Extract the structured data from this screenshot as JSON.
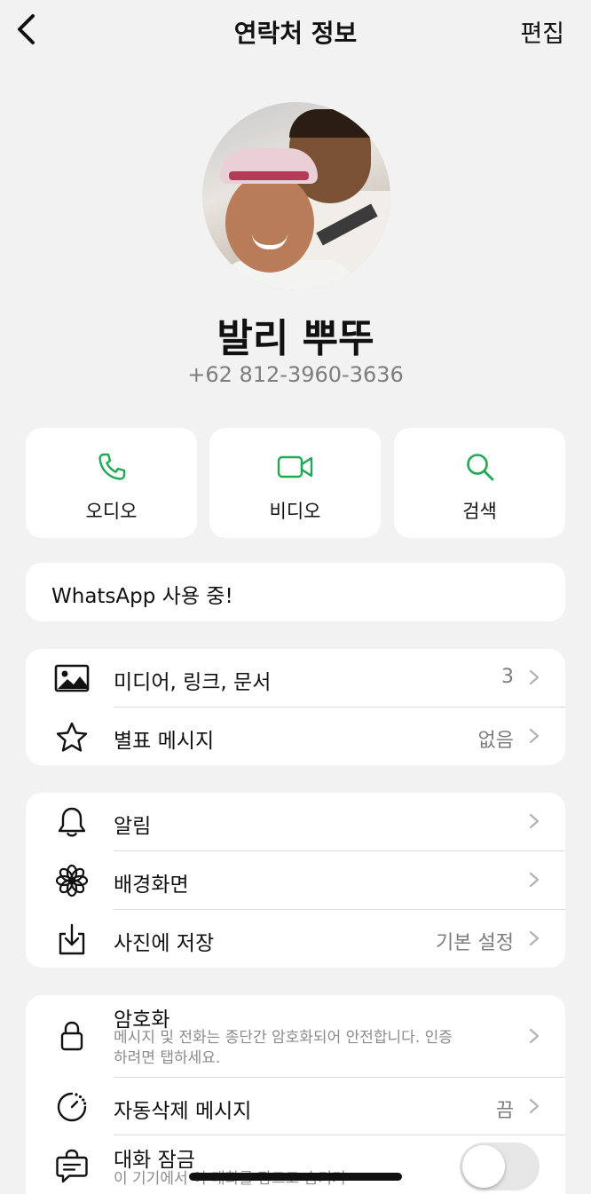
{
  "nav": {
    "title": "연락처 정보",
    "edit_label": "편집"
  },
  "contact": {
    "name": "발리 뿌뚜",
    "phone": "+62 812-3960-3636"
  },
  "actions": [
    {
      "label": "오디오",
      "icon": "phone-icon"
    },
    {
      "label": "비디오",
      "icon": "video-icon"
    },
    {
      "label": "검색",
      "icon": "search-icon"
    }
  ],
  "status": {
    "text": "WhatsApp 사용 중!"
  },
  "media_group": {
    "media": {
      "label": "미디어, 링크, 문서",
      "value": "3",
      "icon": "image-icon"
    },
    "starred": {
      "label": "별표 메시지",
      "value": "없음",
      "icon": "star-icon"
    }
  },
  "settings_group": {
    "notifications": {
      "label": "알림",
      "icon": "bell-icon"
    },
    "wallpaper": {
      "label": "배경화면",
      "icon": "flower-icon"
    },
    "save_photos": {
      "label": "사진에 저장",
      "value": "기본 설정",
      "icon": "save-download-icon"
    }
  },
  "privacy_group": {
    "encryption": {
      "label": "암호화",
      "sub_line1": "메시지 및 전화는 종단간 암호화되어 안전합니다. 인증",
      "sub_line2": "하려면 탭하세요.",
      "icon": "lock-icon"
    },
    "disappearing": {
      "label": "자동삭제 메시지",
      "value": "끔",
      "icon": "timer-icon"
    },
    "chat_lock": {
      "label": "대화 잠금",
      "sub": "이 기기에서 이 대화를 잠그고 숨기기",
      "enabled": false,
      "icon": "chat-lock-icon"
    }
  },
  "colors": {
    "accent": "#1ea952",
    "background": "#f2f2f2",
    "secondary_text": "#7d7d7d"
  }
}
